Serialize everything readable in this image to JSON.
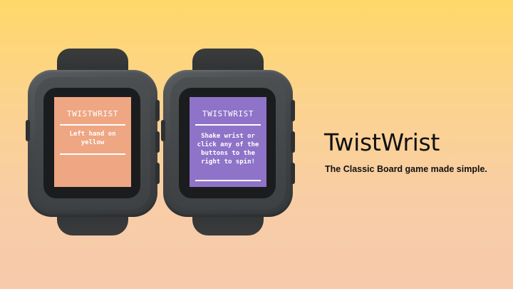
{
  "slide": {
    "title": "TwistWrist",
    "subtitle": "The Classic Board game made simple."
  },
  "watches": [
    {
      "screen_title": "TWISTWRIST",
      "message": "Left hand on yellow",
      "screen_color": "#eea683"
    },
    {
      "screen_title": "TWISTWRIST",
      "message": "Shake wrist or click any of the buttons to the right to spin!",
      "screen_color": "#8e73c8"
    }
  ],
  "colors": {
    "background_top": "#ffd86a",
    "background_bottom": "#f6caab",
    "watch_body": "#434648",
    "text": "#111111"
  }
}
